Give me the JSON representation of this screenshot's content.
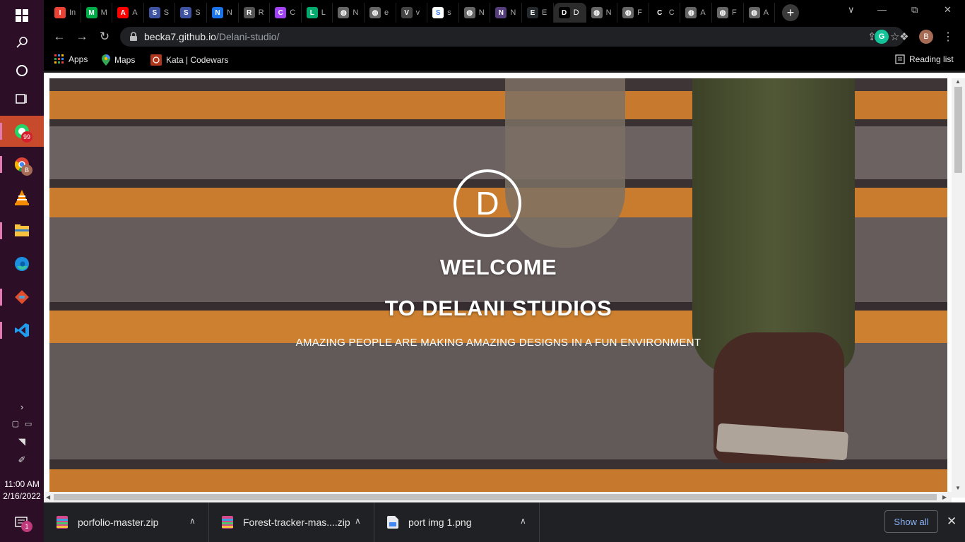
{
  "browser": {
    "tabs": [
      {
        "icon": "gmail-icon",
        "label": "In",
        "color": "#ea4335"
      },
      {
        "icon": "meet-icon",
        "label": "M",
        "color": "#00ac47"
      },
      {
        "icon": "youtube-icon",
        "label": "A",
        "color": "#ff0000"
      },
      {
        "icon": "frontend-mentor-icon",
        "label": "S",
        "color": "#3e54a3"
      },
      {
        "icon": "frontend-mentor-icon",
        "label": "S",
        "color": "#3e54a3"
      },
      {
        "icon": "bookmark-icon",
        "label": "N",
        "color": "#1a73e8"
      },
      {
        "icon": "react-icon",
        "label": "R",
        "color": "#555555"
      },
      {
        "icon": "colorful-icon",
        "label": "C",
        "color": "#a142f4"
      },
      {
        "icon": "w3-icon",
        "label": "L",
        "color": "#04aa6d"
      },
      {
        "icon": "globe-icon",
        "label": "N",
        "color": "#666666"
      },
      {
        "icon": "globe-icon",
        "label": "e",
        "color": "#666666"
      },
      {
        "icon": "openai-icon",
        "label": "v",
        "color": "#444444"
      },
      {
        "icon": "google-icon",
        "label": "s",
        "color": "#ffffff"
      },
      {
        "icon": "globe-icon",
        "label": "N",
        "color": "#666666"
      },
      {
        "icon": "bootstrap-icon",
        "label": "N",
        "color": "#563d7c"
      },
      {
        "icon": "github-icon",
        "label": "E",
        "color": "#24292e"
      },
      {
        "icon": "d-icon",
        "label": "D",
        "color": "#000000",
        "active": true
      },
      {
        "icon": "globe-icon",
        "label": "N",
        "color": "#666666"
      },
      {
        "icon": "globe-icon",
        "label": "F",
        "color": "#666666"
      },
      {
        "icon": "a-icon",
        "label": "C",
        "color": "#000000"
      },
      {
        "icon": "globe-icon",
        "label": "A",
        "color": "#666666"
      },
      {
        "icon": "globe-icon",
        "label": "F",
        "color": "#666666"
      },
      {
        "icon": "globe-icon",
        "label": "A",
        "color": "#666666"
      }
    ],
    "new_tab": "+",
    "url_host": "becka7.github.io",
    "url_path": "/Delani-studio/",
    "avatar_letter": "B",
    "grammarly_letter": "G",
    "reading_list": "Reading list",
    "bookmarks": [
      {
        "icon": "apps-icon",
        "label": "Apps"
      },
      {
        "icon": "maps-icon",
        "label": "Maps"
      },
      {
        "icon": "codewars-icon",
        "label": "Kata | Codewars"
      }
    ]
  },
  "page": {
    "logo_letter": "D",
    "title_line1": "WELCOME",
    "title_line2": "TO DELANI STUDIOS",
    "tagline": "AMAZING PEOPLE ARE MAKING AMAZING DESIGNS IN A FUN ENVIRONMENT"
  },
  "downloads": {
    "items": [
      {
        "name": "porfolio-master.zip",
        "icon": "zip-archive-icon"
      },
      {
        "name": "Forest-tracker-mas....zip",
        "icon": "zip-archive-icon"
      },
      {
        "name": "port img 1.png",
        "icon": "image-file-icon"
      }
    ],
    "show_all": "Show all"
  },
  "taskbar": {
    "whatsapp_badge": "99",
    "chrome_badge": "B",
    "time": "11:00 AM",
    "date": "2/16/2022",
    "notification_count": "1"
  }
}
